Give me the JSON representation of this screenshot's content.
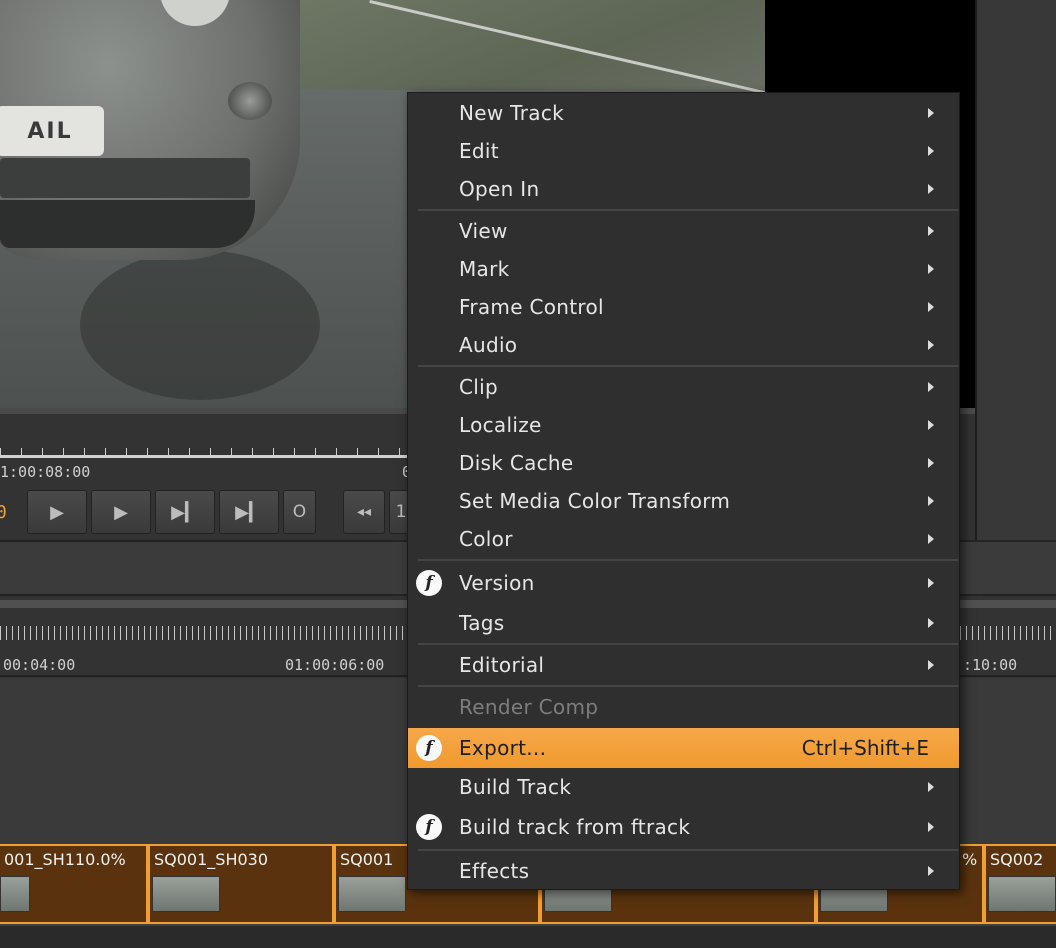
{
  "viewer": {
    "plate_text": "AIL",
    "ruler_timecode_left": "1:00:08:00",
    "ruler_timecode_right": "0",
    "current_frame": "0",
    "buttons": {
      "play": "▶",
      "step_forward": "▶",
      "next_edit": "▶▎",
      "to_end": "▶▎",
      "out_point": "O",
      "rewind": "◂◂",
      "in_label": "1"
    }
  },
  "timeline": {
    "timecodes": [
      "00:04:00",
      "01:00:06:00",
      ":10:00"
    ],
    "clips": [
      {
        "label": "001_SH110.0%"
      },
      {
        "label": "SQ001_SH030"
      },
      {
        "label": "SQ001"
      },
      {
        "label": ""
      },
      {
        "label": "%"
      },
      {
        "label": "SQ002"
      }
    ]
  },
  "context_menu": {
    "items": [
      {
        "label": "New Track",
        "submenu": true
      },
      {
        "label": "Edit",
        "submenu": true
      },
      {
        "label": "Open In",
        "submenu": true
      },
      {
        "label": "View",
        "submenu": true
      },
      {
        "label": "Mark",
        "submenu": true
      },
      {
        "label": "Frame Control",
        "submenu": true
      },
      {
        "label": "Audio",
        "submenu": true
      },
      {
        "label": "Clip",
        "submenu": true
      },
      {
        "label": "Localize",
        "submenu": true
      },
      {
        "label": "Disk Cache",
        "submenu": true
      },
      {
        "label": "Set Media Color Transform",
        "submenu": true
      },
      {
        "label": "Color",
        "submenu": true
      },
      {
        "label": "Version",
        "submenu": true,
        "icon": "ftrack-icon",
        "icon_glyph": "f"
      },
      {
        "label": "Tags",
        "submenu": true
      },
      {
        "label": "Editorial",
        "submenu": true
      },
      {
        "label": "Render Comp",
        "disabled": true
      },
      {
        "label": "Export...",
        "shortcut": "Ctrl+Shift+E",
        "icon": "ftrack-icon",
        "icon_glyph": "f",
        "highlighted": true
      },
      {
        "label": "Build Track",
        "submenu": true
      },
      {
        "label": "Build track from ftrack",
        "submenu": true,
        "icon": "ftrack-icon",
        "icon_glyph": "f"
      },
      {
        "label": "Effects",
        "submenu": true
      }
    ]
  },
  "colors": {
    "highlight": "#f09a2e",
    "clip_border": "#f0a030",
    "clip_fill": "#5a330e",
    "menu_bg": "#2f2f2f"
  }
}
